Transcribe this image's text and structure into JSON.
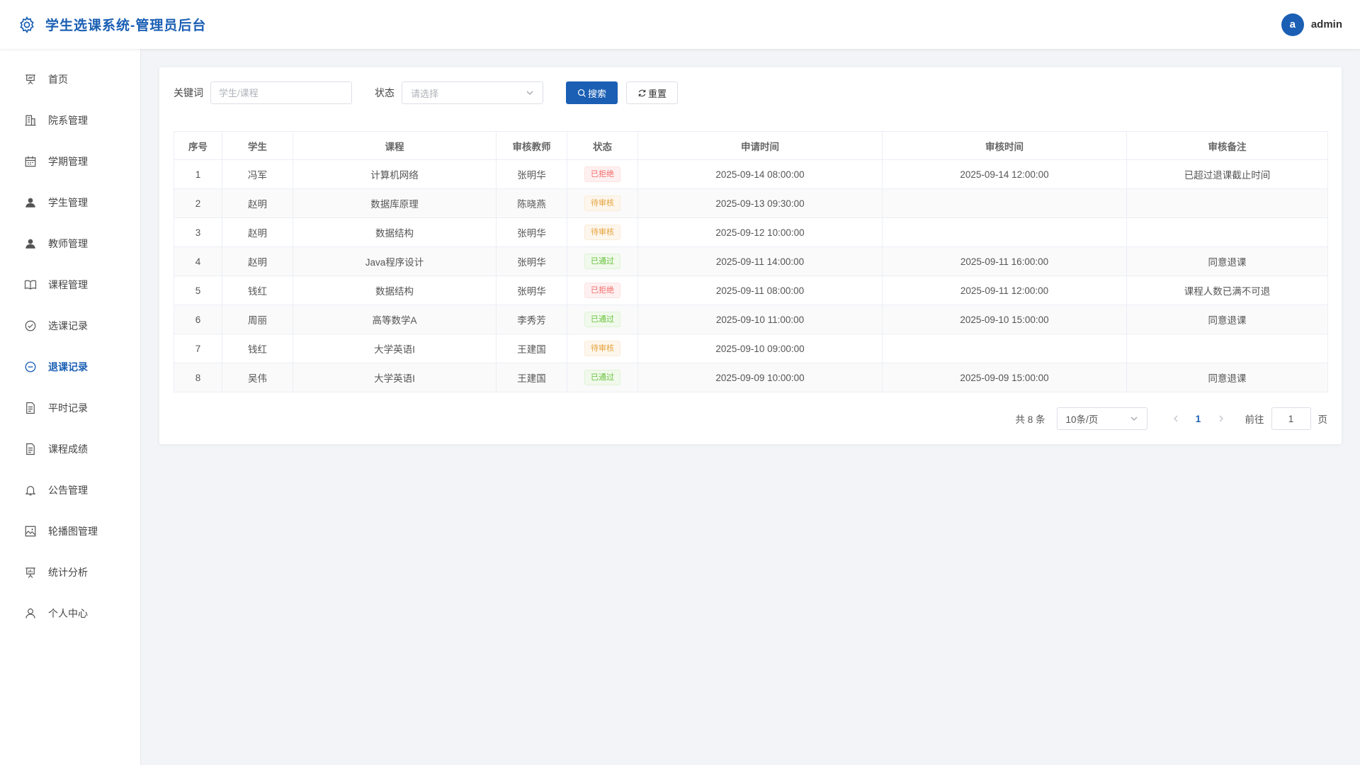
{
  "header": {
    "title": "学生选课系统-管理员后台",
    "avatar_letter": "a",
    "username": "admin"
  },
  "sidebar": {
    "items": [
      {
        "label": "首页",
        "icon": "presentation-icon",
        "active": false
      },
      {
        "label": "院系管理",
        "icon": "building-icon",
        "active": false
      },
      {
        "label": "学期管理",
        "icon": "calendar-icon",
        "active": false
      },
      {
        "label": "学生管理",
        "icon": "user-filled-icon",
        "active": false
      },
      {
        "label": "教师管理",
        "icon": "user-filled-icon",
        "active": false
      },
      {
        "label": "课程管理",
        "icon": "book-icon",
        "active": false
      },
      {
        "label": "选课记录",
        "icon": "check-circle-icon",
        "active": false
      },
      {
        "label": "退课记录",
        "icon": "minus-circle-icon",
        "active": true
      },
      {
        "label": "平时记录",
        "icon": "document-icon",
        "active": false
      },
      {
        "label": "课程成绩",
        "icon": "document-icon",
        "active": false
      },
      {
        "label": "公告管理",
        "icon": "bell-icon",
        "active": false
      },
      {
        "label": "轮播图管理",
        "icon": "image-icon",
        "active": false
      },
      {
        "label": "统计分析",
        "icon": "chart-board-icon",
        "active": false
      },
      {
        "label": "个人中心",
        "icon": "user-outline-icon",
        "active": false
      }
    ]
  },
  "filters": {
    "keyword_label": "关键词",
    "keyword_value": "",
    "keyword_placeholder": "学生/课程",
    "status_label": "状态",
    "status_placeholder": "请选择",
    "search_label": "搜索",
    "reset_label": "重置"
  },
  "table": {
    "columns": [
      "序号",
      "学生",
      "课程",
      "审核教师",
      "状态",
      "申请时间",
      "审核时间",
      "审核备注"
    ],
    "rows": [
      {
        "no": "1",
        "student": "冯军",
        "course": "计算机网络",
        "teacher": "张明华",
        "status": "已拒绝",
        "status_type": "rejected",
        "apply_time": "2025-09-14 08:00:00",
        "review_time": "2025-09-14 12:00:00",
        "remark": "已超过退课截止时间"
      },
      {
        "no": "2",
        "student": "赵明",
        "course": "数据库原理",
        "teacher": "陈晓燕",
        "status": "待审核",
        "status_type": "pending",
        "apply_time": "2025-09-13 09:30:00",
        "review_time": "",
        "remark": ""
      },
      {
        "no": "3",
        "student": "赵明",
        "course": "数据结构",
        "teacher": "张明华",
        "status": "待审核",
        "status_type": "pending",
        "apply_time": "2025-09-12 10:00:00",
        "review_time": "",
        "remark": ""
      },
      {
        "no": "4",
        "student": "赵明",
        "course": "Java程序设计",
        "teacher": "张明华",
        "status": "已通过",
        "status_type": "approved",
        "apply_time": "2025-09-11 14:00:00",
        "review_time": "2025-09-11 16:00:00",
        "remark": "同意退课"
      },
      {
        "no": "5",
        "student": "钱红",
        "course": "数据结构",
        "teacher": "张明华",
        "status": "已拒绝",
        "status_type": "rejected",
        "apply_time": "2025-09-11 08:00:00",
        "review_time": "2025-09-11 12:00:00",
        "remark": "课程人数已满不可退"
      },
      {
        "no": "6",
        "student": "周丽",
        "course": "高等数学A",
        "teacher": "李秀芳",
        "status": "已通过",
        "status_type": "approved",
        "apply_time": "2025-09-10 11:00:00",
        "review_time": "2025-09-10 15:00:00",
        "remark": "同意退课"
      },
      {
        "no": "7",
        "student": "钱红",
        "course": "大学英语I",
        "teacher": "王建国",
        "status": "待审核",
        "status_type": "pending",
        "apply_time": "2025-09-10 09:00:00",
        "review_time": "",
        "remark": ""
      },
      {
        "no": "8",
        "student": "吴伟",
        "course": "大学英语I",
        "teacher": "王建国",
        "status": "已通过",
        "status_type": "approved",
        "apply_time": "2025-09-09 10:00:00",
        "review_time": "2025-09-09 15:00:00",
        "remark": "同意退课"
      }
    ]
  },
  "pagination": {
    "total_text": "共 8 条",
    "page_size": "10条/页",
    "current_page": "1",
    "goto_label": "前往",
    "goto_value": "1",
    "page_unit": "页"
  },
  "colors": {
    "accent": "#1a5fb4",
    "rejected": "#f56c6c",
    "pending": "#e6a23c",
    "approved": "#67c23a"
  }
}
